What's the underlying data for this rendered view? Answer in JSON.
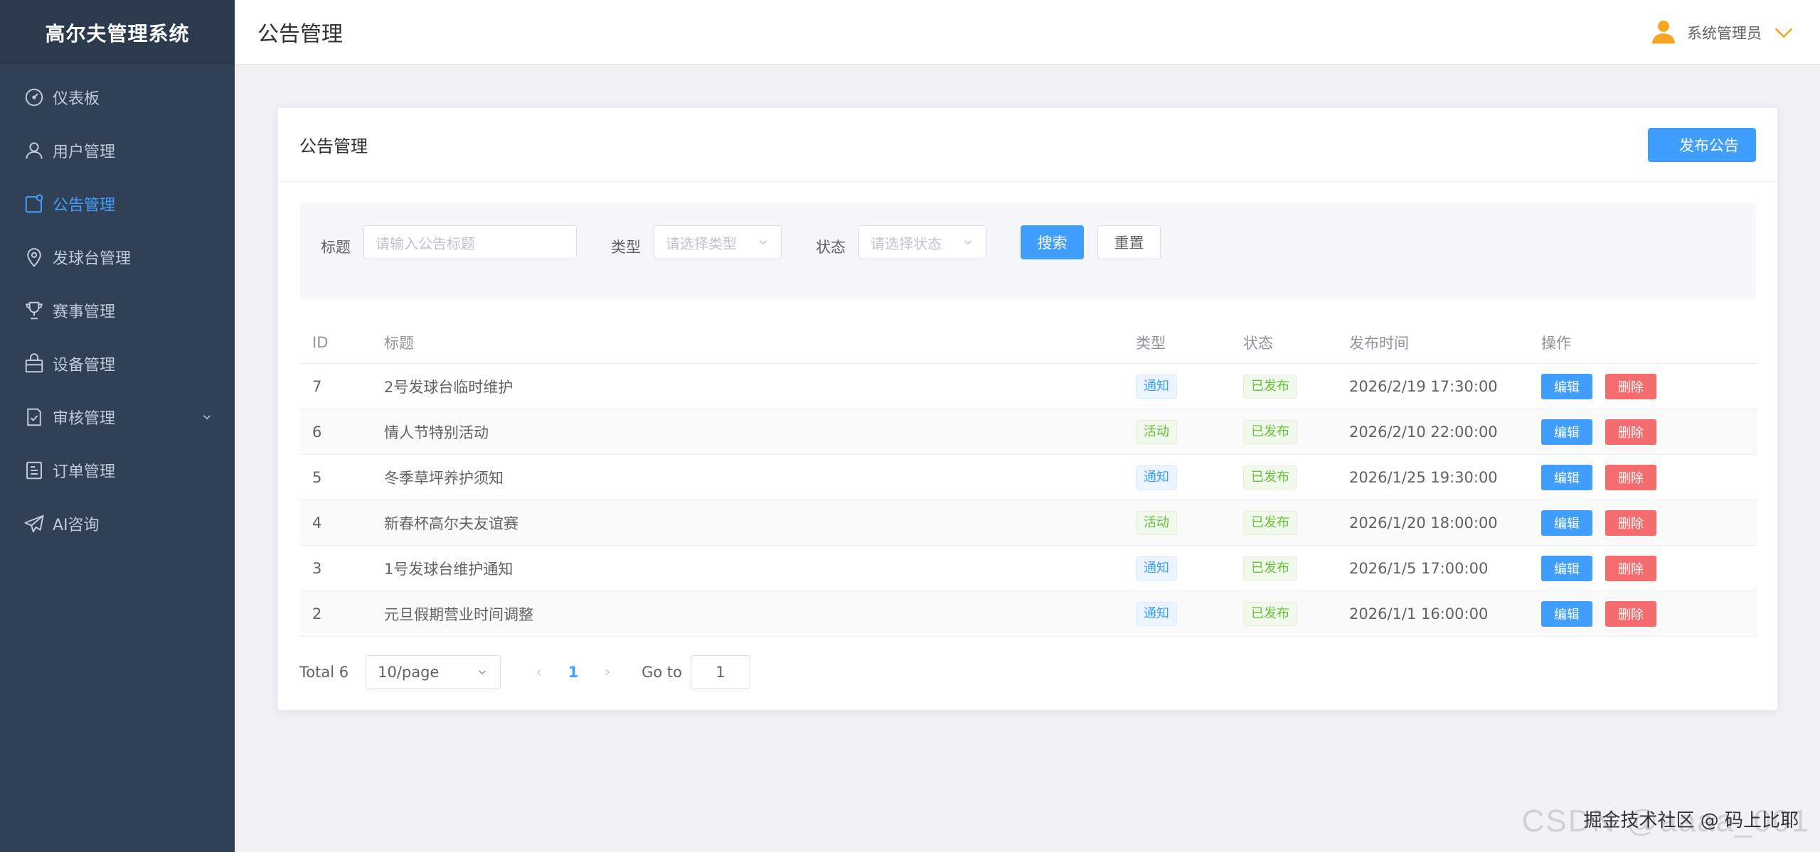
{
  "app": {
    "title": "高尔夫管理系统"
  },
  "sidebar": {
    "items": [
      {
        "label": "仪表板",
        "icon": "dashboard-icon"
      },
      {
        "label": "用户管理",
        "icon": "user-icon"
      },
      {
        "label": "公告管理",
        "icon": "notice-icon",
        "active": true
      },
      {
        "label": "发球台管理",
        "icon": "location-icon"
      },
      {
        "label": "赛事管理",
        "icon": "trophy-icon"
      },
      {
        "label": "设备管理",
        "icon": "bag-icon"
      },
      {
        "label": "审核管理",
        "icon": "audit-icon",
        "expandable": true
      },
      {
        "label": "订单管理",
        "icon": "order-icon"
      },
      {
        "label": "AI咨询",
        "icon": "send-icon"
      }
    ]
  },
  "header": {
    "title": "公告管理",
    "user": "系统管理员"
  },
  "card": {
    "title": "公告管理",
    "publish_label": "发布公告"
  },
  "filter": {
    "title_label": "标题",
    "title_placeholder": "请输入公告标题",
    "type_label": "类型",
    "type_placeholder": "请选择类型",
    "status_label": "状态",
    "status_placeholder": "请选择状态",
    "search_label": "搜索",
    "reset_label": "重置"
  },
  "table": {
    "headers": {
      "id": "ID",
      "title": "标题",
      "type": "类型",
      "status": "状态",
      "time": "发布时间",
      "op": "操作"
    },
    "edit_label": "编辑",
    "delete_label": "删除",
    "rows": [
      {
        "id": "7",
        "title": "2号发球台临时维护",
        "type": "通知",
        "status": "已发布",
        "time": "2026/2/19 17:30:00"
      },
      {
        "id": "6",
        "title": "情人节特别活动",
        "type": "活动",
        "status": "已发布",
        "time": "2026/2/10 22:00:00"
      },
      {
        "id": "5",
        "title": "冬季草坪养护须知",
        "type": "通知",
        "status": "已发布",
        "time": "2026/1/25 19:30:00"
      },
      {
        "id": "4",
        "title": "新春杯高尔夫友谊赛",
        "type": "活动",
        "status": "已发布",
        "time": "2026/1/20 18:00:00"
      },
      {
        "id": "3",
        "title": "1号发球台维护通知",
        "type": "通知",
        "status": "已发布",
        "time": "2026/1/5 17:00:00"
      },
      {
        "id": "2",
        "title": "元旦假期营业时间调整",
        "type": "通知",
        "status": "已发布",
        "time": "2026/1/1 16:00:00"
      }
    ]
  },
  "pagination": {
    "total": "Total 6",
    "page_size": "10/page",
    "current": "1",
    "goto_label": "Go to",
    "goto_value": "1"
  },
  "watermark": {
    "text": "CSDN @aaaa_001",
    "overlay": "掘金技术社区 @ 码上比耶"
  },
  "colors": {
    "primary": "#409eff",
    "danger": "#f56c6c",
    "success": "#67c23a",
    "sidebar": "#304156"
  }
}
